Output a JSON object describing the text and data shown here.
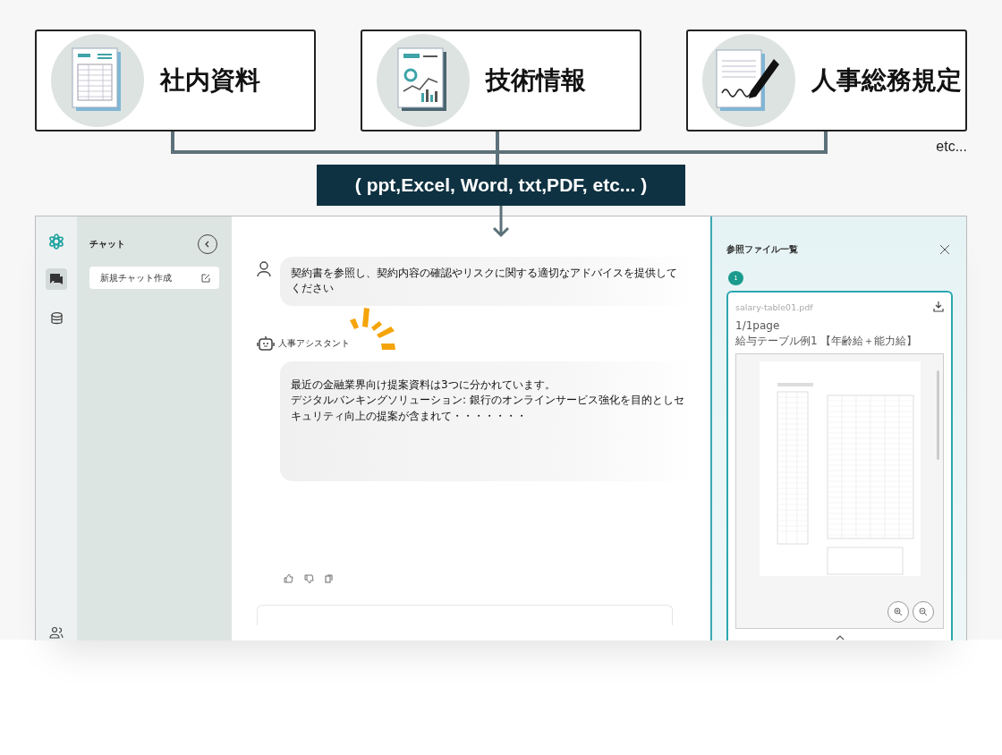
{
  "sources": [
    {
      "kind": "form",
      "label": "社内資料"
    },
    {
      "kind": "chart",
      "label": "技術情報"
    },
    {
      "kind": "contract",
      "label": "人事総務規定"
    }
  ],
  "more_label": "etc...",
  "formats_label": "( ppt,Excel, Word, txt,PDF, etc... )",
  "app": {
    "rail": [
      {
        "kind": "chat",
        "selected": true
      },
      {
        "kind": "database",
        "selected": false
      }
    ],
    "sidebar": {
      "title": "チャット",
      "new_chat": "新規チャット作成"
    },
    "messages": [
      {
        "kind": "user",
        "paragraphs": [
          "契約書を参照し、契約内容の確認やリスクに関する適切なアドバイスを提供してください"
        ]
      },
      {
        "kind": "assistant",
        "name": "人事アシスタント",
        "paragraphs": [
          "最近の金融業界向け提案資料は3つに分かれています。",
          "デジタルバンキングソリューション: 銀行のオンラインサービス強化を目的としセキュリティ向上の提案が含まれて・・・・・・・"
        ]
      }
    ],
    "references": {
      "title": "参照ファイル一覧",
      "items": [
        {
          "number": "1",
          "filename": "salary-table01.pdf",
          "pages": "1/1page",
          "caption": "給与テーブル例1 【年齢給＋能力給】"
        }
      ]
    }
  }
}
